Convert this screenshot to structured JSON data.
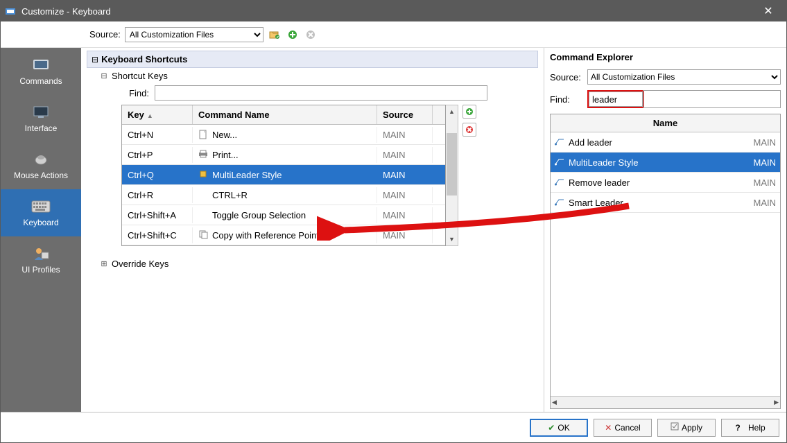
{
  "window": {
    "title": "Customize - Keyboard"
  },
  "topbar": {
    "source_label": "Source:",
    "source_value": "All Customization Files"
  },
  "sidebar": {
    "items": [
      {
        "label": "Commands"
      },
      {
        "label": "Interface"
      },
      {
        "label": "Mouse Actions"
      },
      {
        "label": "Keyboard"
      },
      {
        "label": "UI Profiles"
      }
    ]
  },
  "center": {
    "section_title": "Keyboard Shortcuts",
    "tree_shortcut": "Shortcut Keys",
    "tree_override": "Override Keys",
    "find_label": "Find:",
    "grid": {
      "headers": {
        "key": "Key",
        "cmd": "Command Name",
        "src": "Source"
      },
      "rows": [
        {
          "key": "Ctrl+N",
          "cmd": "New...",
          "src": "MAIN",
          "icon": "doc"
        },
        {
          "key": "Ctrl+P",
          "cmd": "Print...",
          "src": "MAIN",
          "icon": "print"
        },
        {
          "key": "Ctrl+Q",
          "cmd": "MultiLeader Style",
          "src": "MAIN",
          "icon": "ml",
          "selected": true
        },
        {
          "key": "Ctrl+R",
          "cmd": "CTRL+R",
          "src": "MAIN",
          "icon": ""
        },
        {
          "key": "Ctrl+Shift+A",
          "cmd": "Toggle Group Selection",
          "src": "MAIN",
          "icon": ""
        },
        {
          "key": "Ctrl+Shift+C",
          "cmd": "Copy with Reference Point",
          "src": "MAIN",
          "icon": "copy"
        }
      ]
    }
  },
  "right": {
    "title": "Command Explorer",
    "source_label": "Source:",
    "source_value": "All Customization Files",
    "find_label": "Find:",
    "find_value": "leader",
    "name_header": "Name",
    "rows": [
      {
        "name": "Add leader",
        "src": "MAIN"
      },
      {
        "name": "MultiLeader Style",
        "src": "MAIN",
        "selected": true
      },
      {
        "name": "Remove leader",
        "src": "MAIN"
      },
      {
        "name": "Smart Leader",
        "src": "MAIN"
      }
    ]
  },
  "buttons": {
    "ok": "OK",
    "cancel": "Cancel",
    "apply": "Apply",
    "help": "Help"
  }
}
